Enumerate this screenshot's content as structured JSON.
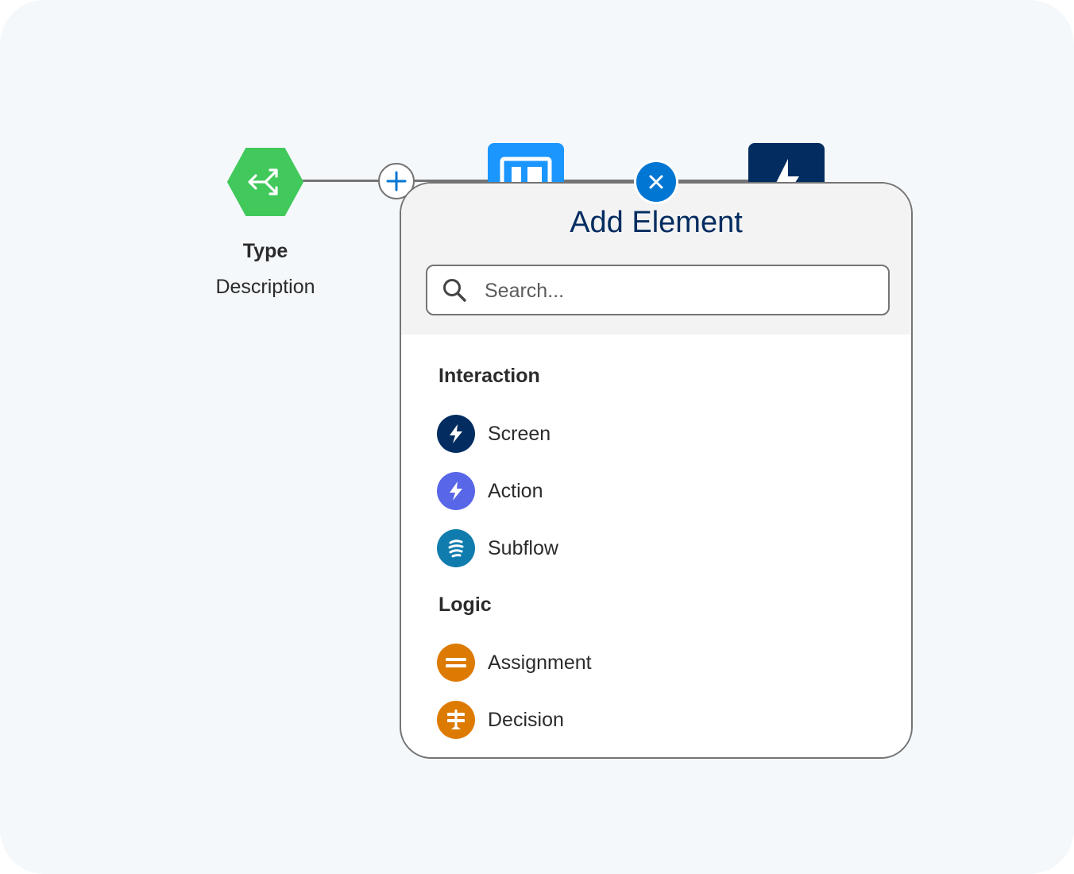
{
  "canvas": {
    "start_node": {
      "icon": "flow-start-icon",
      "title": "Type",
      "description": "Description"
    },
    "nodes": [
      {
        "icon": "screen-icon",
        "color": "#1b96ff"
      },
      {
        "icon": "lightning-icon",
        "color": "#032d60"
      }
    ],
    "add_button_icon": "plus-icon",
    "close_button_icon": "close-icon"
  },
  "panel": {
    "title": "Add Element",
    "search": {
      "placeholder": "Search...",
      "value": "",
      "icon": "search-icon"
    },
    "sections": [
      {
        "heading": "Interaction",
        "items": [
          {
            "label": "Screen",
            "icon": "lightning-icon",
            "color": "#032d60"
          },
          {
            "label": "Action",
            "icon": "lightning-icon",
            "color": "#5867e8"
          },
          {
            "label": "Subflow",
            "icon": "subflow-icon",
            "color": "#107cad"
          }
        ]
      },
      {
        "heading": "Logic",
        "items": [
          {
            "label": "Assignment",
            "icon": "equals-icon",
            "color": "#dd7a01"
          },
          {
            "label": "Decision",
            "icon": "signpost-icon",
            "color": "#dd7a01"
          }
        ]
      }
    ]
  },
  "colors": {
    "accent": "#0176d3",
    "start_node": "#41c95b",
    "panel_header_bg": "#f3f3f3"
  }
}
